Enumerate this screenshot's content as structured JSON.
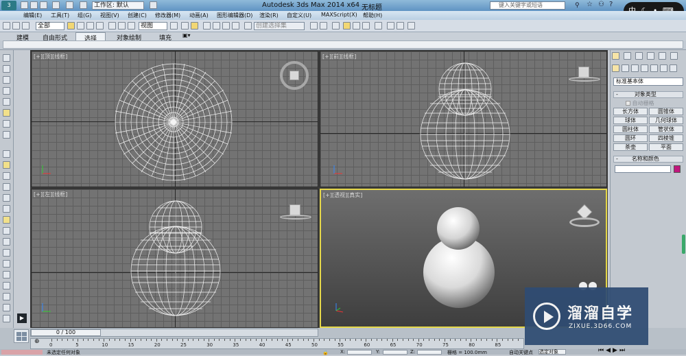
{
  "window": {
    "app_title": "Autodesk 3ds Max  2014 x64",
    "doc_title": "无标题",
    "search_placeholder": "键入关键字或短语"
  },
  "quick_access": {
    "workspace_label": "工作区: 默认"
  },
  "menu": [
    "编辑(E)",
    "工具(T)",
    "组(G)",
    "视图(V)",
    "创建(C)",
    "修改器(M)",
    "动画(A)",
    "图形编辑器(D)",
    "渲染(R)",
    "自定义(U)",
    "MAXScript(X)",
    "帮助(H)"
  ],
  "toolbar": {
    "filter_select": "全部",
    "coord_select": "视图",
    "selection_set_placeholder": "创建选择集"
  },
  "ribbon_tabs": [
    "建模",
    "自由形式",
    "选择",
    "对象绘制",
    "填充"
  ],
  "ribbon_active": "选择",
  "viewports": {
    "top": {
      "label": "[+][顶][线框]"
    },
    "front": {
      "label": "[+][前][线框]"
    },
    "left": {
      "label": "[+][左][线框]"
    },
    "persp": {
      "label": "[+][透视][真实]"
    }
  },
  "command_panel": {
    "category_select": "标准基本体",
    "rollout_object_type": "对象类型",
    "autogrid_label": "自动栅格",
    "buttons": [
      "长方体",
      "圆锥体",
      "球体",
      "几何球体",
      "圆柱体",
      "管状体",
      "圆环",
      "四棱锥",
      "茶壶",
      "平面"
    ],
    "rollout_name_color": "名称和颜色",
    "object_color": "#c0177d"
  },
  "timeline": {
    "frame_display": "0 / 100",
    "ticks": [
      "0",
      "5",
      "10",
      "15",
      "20",
      "25",
      "30",
      "35",
      "40",
      "45",
      "50",
      "55",
      "60",
      "65",
      "70",
      "75",
      "80",
      "85"
    ]
  },
  "status": {
    "selection_text": "未选定任何对象",
    "grid_text": "栅格 = 100.0mm",
    "autokey_label": "自动关键点",
    "set_key_label": "选定对象",
    "x_label": "X:",
    "y_label": "Y:",
    "z_label": "Z:"
  },
  "watermark": {
    "title": "溜溜自学",
    "url": "ZIXUE.3D66.COM"
  },
  "ime": {
    "label": "中"
  },
  "colors": {
    "accent": "#3e6fa3",
    "active_viewport_border": "#e6d84a",
    "watermark_bg": "#2f4c73"
  }
}
